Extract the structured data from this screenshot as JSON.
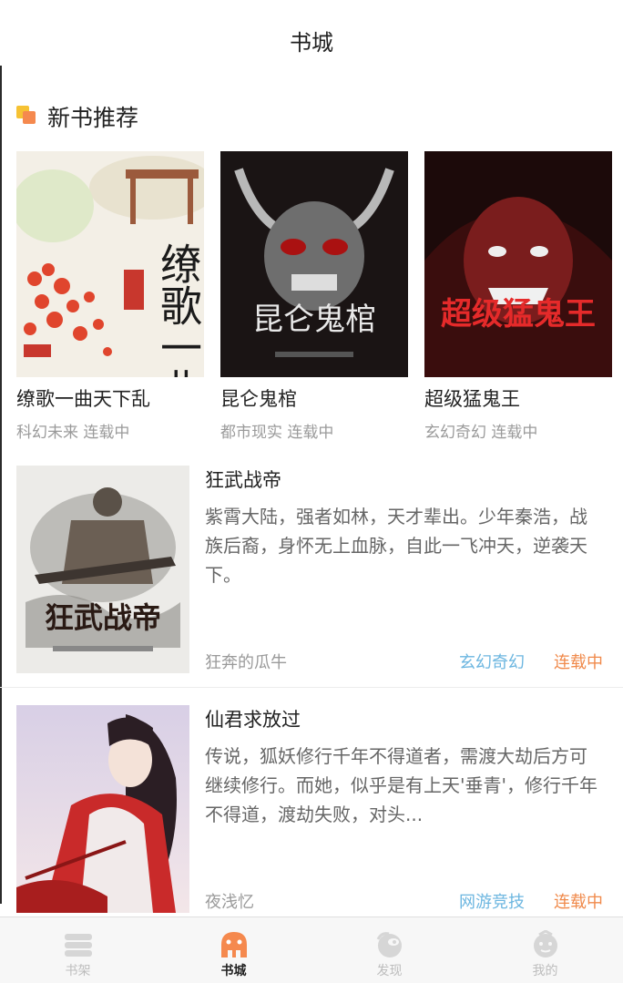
{
  "header": {
    "title": "书城"
  },
  "section": {
    "title": "新书推荐"
  },
  "featured": [
    {
      "name": "缭歌一曲天下乱",
      "meta": "科幻未来 连载中",
      "cover_text": "缭歌一曲"
    },
    {
      "name": "昆仑鬼棺",
      "meta": "都市现实 连载中",
      "cover_text": "昆仑鬼棺"
    },
    {
      "name": "超级猛鬼王",
      "meta": "玄幻奇幻 连载中",
      "cover_text": "超级猛鬼王"
    }
  ],
  "list": [
    {
      "title": "狂武战帝",
      "desc": "紫霄大陆，强者如林，天才辈出。少年秦浩，战族后裔，身怀无上血脉，自此一飞冲天，逆袭天下。",
      "author": "狂奔的瓜牛",
      "genre": "玄幻奇幻",
      "status": "连载中",
      "cover_text": "狂武战帝"
    },
    {
      "title": "仙君求放过",
      "desc": "传说，狐妖修行千年不得道者，需渡大劫后方可继续修行。而她，似乎是有上天'垂青'，修行千年不得道，渡劫失败，对头...",
      "author": "夜浅忆",
      "genre": "网游竞技",
      "status": "连载中"
    }
  ],
  "tabs": [
    {
      "label": "书架",
      "icon": "bookshelf-icon"
    },
    {
      "label": "书城",
      "icon": "bookstore-icon"
    },
    {
      "label": "发现",
      "icon": "discover-icon"
    },
    {
      "label": "我的",
      "icon": "profile-icon"
    }
  ],
  "colors": {
    "accent": "#f5894e",
    "genre": "#6cb6e0",
    "status": "#f08a4b"
  }
}
